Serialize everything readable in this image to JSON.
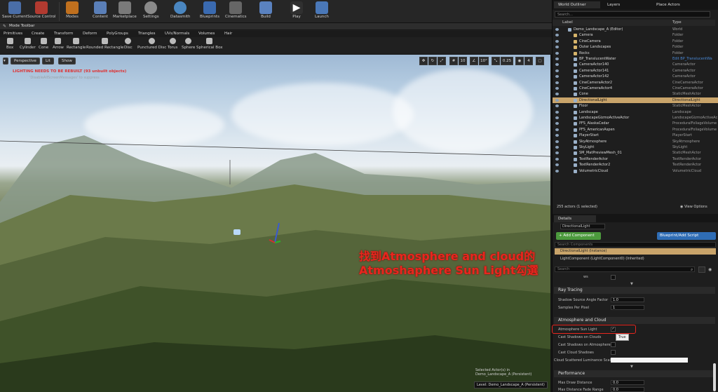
{
  "toolbar": {
    "items": [
      "Save Current",
      "Source Control",
      "Modes",
      "Content",
      "Marketplace",
      "Settings",
      "Datasmith",
      "Blueprints",
      "Cinematics",
      "Build",
      "Play",
      "Launch"
    ]
  },
  "modes": {
    "title": "Mode Toolbar",
    "tabs": [
      "Primitives",
      "Create",
      "Transform",
      "Deform",
      "PolyGroups",
      "Triangles",
      "UVs/Normals",
      "Volumes",
      "Hair"
    ],
    "shapes": [
      "Box",
      "Cylinder",
      "Cone",
      "Arrow",
      "Rectangle",
      "Rounded Rectangle",
      "Disc",
      "Punctured Disc",
      "Torus",
      "Sphere",
      "Spherical Box"
    ]
  },
  "viewport": {
    "perspective": "Perspective",
    "lit": "Lit",
    "show": "Show",
    "warning": "LIGHTING NEEDS TO BE REBUILT (93 unbuilt objects)",
    "suppress": "'DisableAllScreenMessages' to suppress",
    "grid": "10",
    "angle": "10°",
    "scale": "0.25",
    "cam": "4",
    "selected_info": "Selected Actor(s) in",
    "selected_level": "Demo_Landscape_A (Persistent)",
    "level_label": "Level:  Demo_Landscape_A (Persistent)",
    "annotation_line1": "找到Atmosphere and cloud的",
    "annotation_line2": "Atmoshaphere Sun Light勾選"
  },
  "outliner": {
    "tabs": [
      "World Outliner",
      "Layers",
      "Place Actors"
    ],
    "search": "Search...",
    "col_label": "Label",
    "col_type": "Type",
    "rows": [
      {
        "label": "Demo_Landscape_A (Editor)",
        "type": "World",
        "indent": 0
      },
      {
        "label": "Camera",
        "type": "Folder",
        "indent": 1
      },
      {
        "label": "CineCamera",
        "type": "Folder",
        "indent": 1
      },
      {
        "label": "Outer Landscapes",
        "type": "Folder",
        "indent": 1
      },
      {
        "label": "Rocks",
        "type": "Folder",
        "indent": 1
      },
      {
        "label": "BP_TranslucentWater",
        "type": "Edit BP_TranslucentWa",
        "indent": 1
      },
      {
        "label": "CameraActor140",
        "type": "CameraActor",
        "indent": 1
      },
      {
        "label": "CameraActor141",
        "type": "CameraActor",
        "indent": 1
      },
      {
        "label": "CameraActor142",
        "type": "CameraActor",
        "indent": 1
      },
      {
        "label": "CineCameraActor2",
        "type": "CineCameraActor",
        "indent": 1
      },
      {
        "label": "CineCameraActor4",
        "type": "CineCameraActor",
        "indent": 1
      },
      {
        "label": "Cone",
        "type": "StaticMeshActor",
        "indent": 1
      },
      {
        "label": "DirectionalLight",
        "type": "DirectionalLight",
        "indent": 1,
        "selected": true
      },
      {
        "label": "Floor",
        "type": "StaticMeshActor",
        "indent": 1
      },
      {
        "label": "Landscape",
        "type": "Landscape",
        "indent": 1
      },
      {
        "label": "LandscapeGizmoActiveActor",
        "type": "LandscapeGizmoActiveAc",
        "indent": 1
      },
      {
        "label": "PFS_AlaskaCedar",
        "type": "ProceduralFoliageVolume",
        "indent": 1
      },
      {
        "label": "PFS_AmericanAspen",
        "type": "ProceduralFoliageVolume",
        "indent": 1
      },
      {
        "label": "PlayerStart",
        "type": "PlayerStart",
        "indent": 1
      },
      {
        "label": "SkyAtmosphere",
        "type": "SkyAtmosphere",
        "indent": 1
      },
      {
        "label": "SkyLight",
        "type": "SkyLight",
        "indent": 1
      },
      {
        "label": "SM_MatPreviewMesh_01",
        "type": "StaticMeshActor",
        "indent": 1
      },
      {
        "label": "TextRenderActor",
        "type": "TextRenderActor",
        "indent": 1
      },
      {
        "label": "TextRenderActor2",
        "type": "TextRenderActor",
        "indent": 1
      },
      {
        "label": "VolumetricCloud",
        "type": "VolumetricCloud",
        "indent": 1
      }
    ],
    "count": "255 actors (1 selected)",
    "view_options": "View Options"
  },
  "details": {
    "tab": "Details",
    "name": "DirectionalLight",
    "add_component": "+ Add Component",
    "blueprint": "Blueprint/Add Script",
    "search_components": "Search Components",
    "instance": "DirectionalLight (Instance)",
    "component": "LightComponent (LightComponent0) (Inherited)",
    "search": "Search",
    "shadows_label": "ws",
    "sections": {
      "ray_tracing": "Ray Tracing",
      "atmosphere": "Atmosphere and Cloud",
      "performance": "Performance"
    },
    "props": {
      "shadow_angle": "Shadow Source Angle Factor",
      "shadow_angle_val": "1.0",
      "samples": "Samples Per Pixel",
      "samples_val": "1",
      "atmo_sun": "Atmosphere Sun Light",
      "tooltip": "True",
      "cast_clouds": "Cast Shadows on Clouds",
      "cast_atmo": "Cast Shadows on Atmosphere",
      "cast_cloud_shadows": "Cast Cloud Shadows",
      "cloud_scatter": "Cloud Scattered Luminance Scal",
      "max_draw": "Max Draw Distance",
      "max_draw_val": "0.0",
      "max_fade": "Max Distance Fade Range",
      "max_fade_val": "0.0"
    }
  },
  "colors": {
    "accent": "#e07b22",
    "selected_row": "#c9a46a",
    "annotation": "#e8261e",
    "add_component": "#4c9a3d",
    "blueprint": "#2f6db5"
  }
}
